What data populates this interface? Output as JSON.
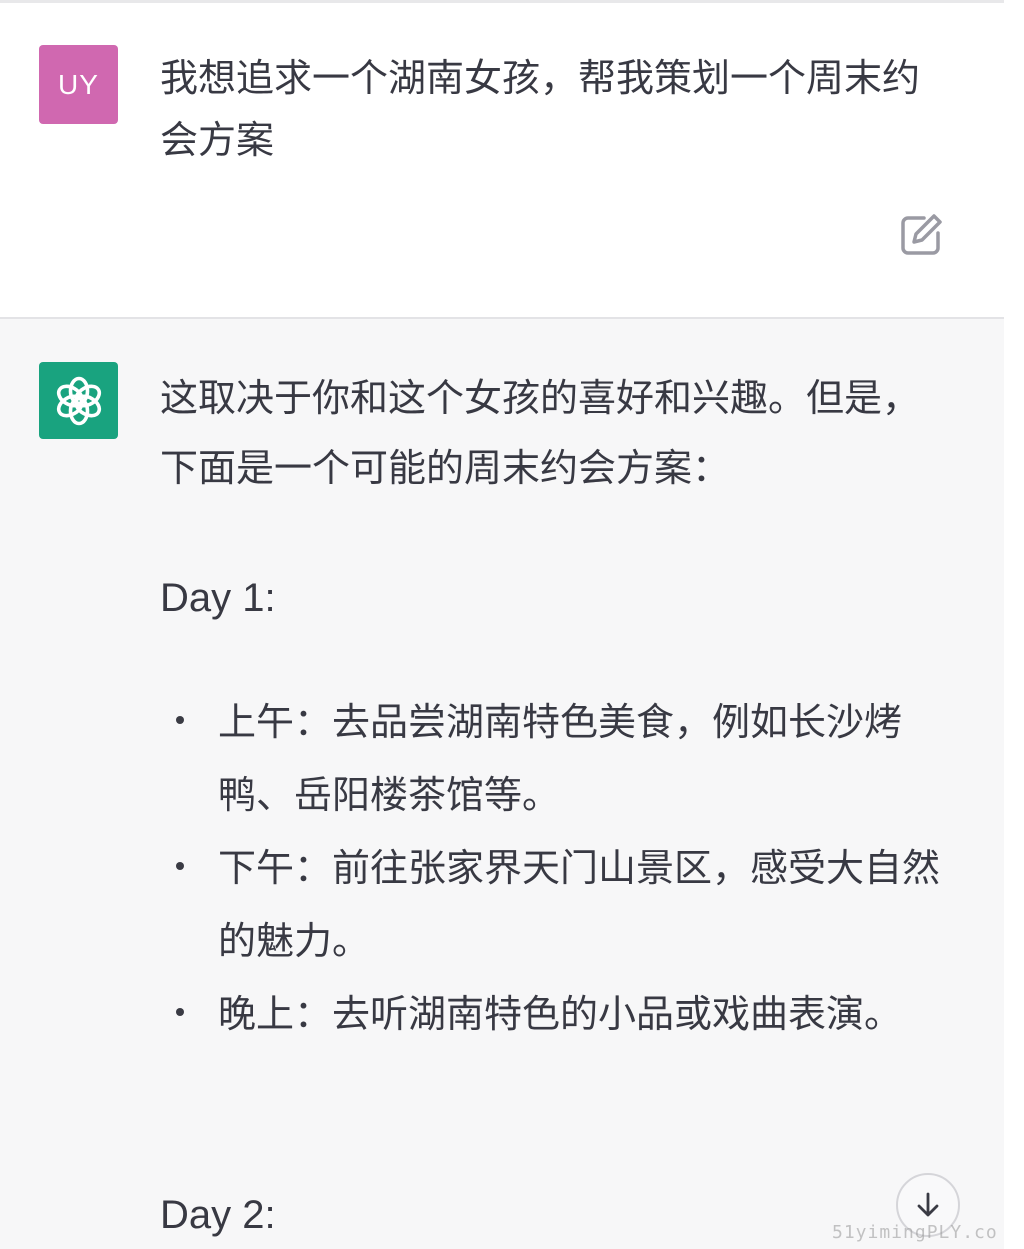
{
  "user_message": {
    "avatar_initials": "UY",
    "avatar_color": "#d068b0",
    "text": "我想追求一个湖南女孩，帮我策划一个周末约会方案",
    "edit_icon": "edit-icon"
  },
  "assistant_message": {
    "avatar_icon": "openai-logo-icon",
    "avatar_color": "#19a37f",
    "intro": "这取决于你和这个女孩的喜好和兴趣。但是，下面是一个可能的周末约会方案：",
    "day1_heading": "Day 1:",
    "day1_items": [
      "上午：去品尝湖南特色美食，例如长沙烤鸭、岳阳楼茶馆等。",
      "下午：前往张家界天门山景区，感受大自然的魅力。",
      "晚上：去听湖南特色的小品或戏曲表演。"
    ],
    "day2_heading": "Day 2:"
  },
  "scroll_button_icon": "arrow-down-icon",
  "watermark": "51yimingPLY.co"
}
